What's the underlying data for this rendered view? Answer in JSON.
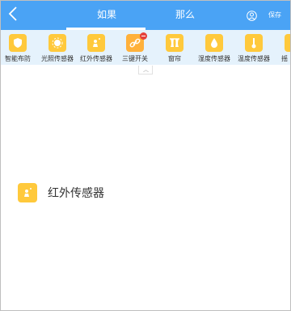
{
  "header": {
    "tabs": [
      {
        "label": "如果"
      },
      {
        "label": "那么"
      }
    ],
    "save_label": "保存",
    "accent_color": "#4aa3f5"
  },
  "devices": [
    {
      "label": "智能布防",
      "icon": "shield-icon"
    },
    {
      "label": "光照传感器",
      "icon": "sun-icon"
    },
    {
      "label": "红外传感器",
      "icon": "person-infrared-icon"
    },
    {
      "label": "三键开关",
      "icon": "link-switch-icon"
    },
    {
      "label": "窗帘",
      "icon": "curtain-icon"
    },
    {
      "label": "湿度传感器",
      "icon": "droplet-icon"
    },
    {
      "label": "温度传感器",
      "icon": "thermometer-icon"
    },
    {
      "label": "摇",
      "icon": "partial-icon"
    }
  ],
  "collapse_glyph": "︿",
  "selected": {
    "label": "红外传感器",
    "icon": "person-infrared-icon"
  }
}
